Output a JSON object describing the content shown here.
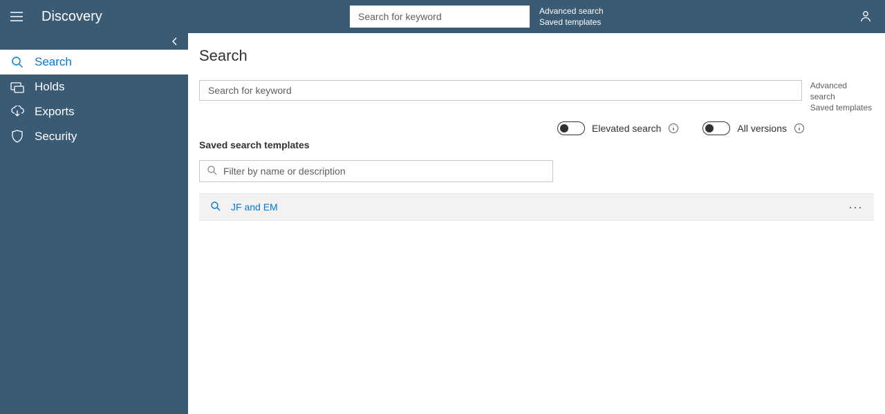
{
  "header": {
    "app_title": "Discovery",
    "search_placeholder": "Search for keyword",
    "advanced_search_label": "Advanced search",
    "saved_templates_label": "Saved templates"
  },
  "sidebar": {
    "items": [
      {
        "label": "Search",
        "active": true
      },
      {
        "label": "Holds",
        "active": false
      },
      {
        "label": "Exports",
        "active": false
      },
      {
        "label": "Security",
        "active": false
      }
    ]
  },
  "main": {
    "page_title": "Search",
    "search_placeholder": "Search for keyword",
    "right_links": {
      "advanced": "Advanced search",
      "saved": "Saved templates"
    },
    "toggles": {
      "elevated_label": "Elevated search",
      "allversions_label": "All versions"
    },
    "saved_section_label": "Saved search templates",
    "filter_placeholder": "Filter by name or description",
    "templates": [
      {
        "name": "JF and EM"
      }
    ]
  }
}
